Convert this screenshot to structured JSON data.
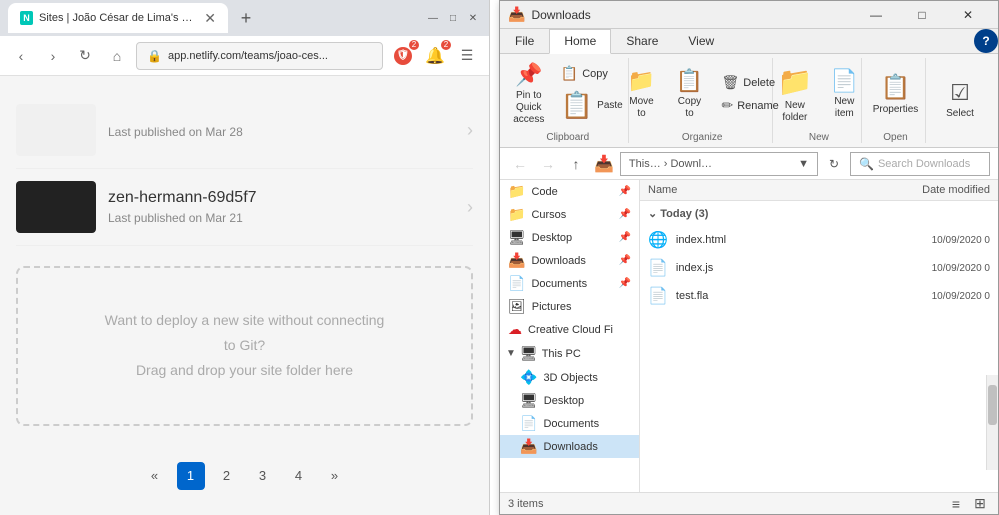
{
  "browser": {
    "tab": {
      "title": "Sites | João César de Lima's team",
      "favicon": "N",
      "url": "app.netlify.com/teams/joao-ces..."
    },
    "sites": [
      {
        "name": "zen-hermann-69d5f7",
        "date": "Last published on Mar 21"
      }
    ],
    "deploy_box": {
      "line1": "Want to deploy a new site without connecting",
      "line2": "to Git?",
      "line3": "Drag and drop your site folder here"
    },
    "pagination": {
      "pages": [
        "«",
        "1",
        "2",
        "3",
        "4",
        "»"
      ],
      "active": "1"
    }
  },
  "explorer": {
    "title": "Downloads",
    "ribbon": {
      "tabs": [
        "File",
        "Home",
        "Share",
        "View"
      ],
      "active_tab": "Home",
      "groups": {
        "clipboard": {
          "label": "Clipboard",
          "pin_label": "Pin to Quick\naccess",
          "copy_label": "Copy",
          "paste_label": "Paste"
        },
        "organize": {
          "label": "Organize"
        },
        "new": {
          "label": "New",
          "new_folder_label": "New\nfolder"
        },
        "open": {
          "label": "Open",
          "properties_label": "Properties"
        },
        "select": {
          "label": "Select",
          "select_label": "Select"
        }
      }
    },
    "address": {
      "back": "←",
      "forward": "→",
      "up": "↑",
      "breadcrumb": "This… › Downl…",
      "search_placeholder": "Search Downloads"
    },
    "sidebar": {
      "quick_access": [
        {
          "label": "Code",
          "icon": "📁",
          "pinned": true
        },
        {
          "label": "Cursos",
          "icon": "📁",
          "pinned": true
        },
        {
          "label": "Desktop",
          "icon": "🖥",
          "pinned": true
        },
        {
          "label": "Downloads",
          "icon": "📥",
          "pinned": true
        },
        {
          "label": "Documents",
          "icon": "📄",
          "pinned": true
        },
        {
          "label": "Pictures",
          "icon": "🖼",
          "pinned": false
        }
      ],
      "creative_cloud": "Creative Cloud Fi",
      "this_pc": {
        "label": "This PC",
        "items": [
          {
            "label": "3D Objects",
            "icon": "💠"
          },
          {
            "label": "Desktop",
            "icon": "🖥"
          },
          {
            "label": "Documents",
            "icon": "📄"
          },
          {
            "label": "Downloads",
            "icon": "📥",
            "active": true
          }
        ]
      }
    },
    "filelist": {
      "headers": {
        "name": "Name",
        "date": "Date modified"
      },
      "groups": [
        {
          "label": "Today (3)",
          "files": [
            {
              "name": "index.html",
              "icon": "🌐",
              "date": "10/09/2020 0",
              "color": "#c0392b"
            },
            {
              "name": "index.js",
              "icon": "📄",
              "date": "10/09/2020 0",
              "color": "#555"
            },
            {
              "name": "test.fla",
              "icon": "📄",
              "date": "10/09/2020 0",
              "color": "#555"
            }
          ]
        }
      ]
    },
    "statusbar": {
      "items_count": "3 items",
      "items_label": "Items"
    }
  }
}
